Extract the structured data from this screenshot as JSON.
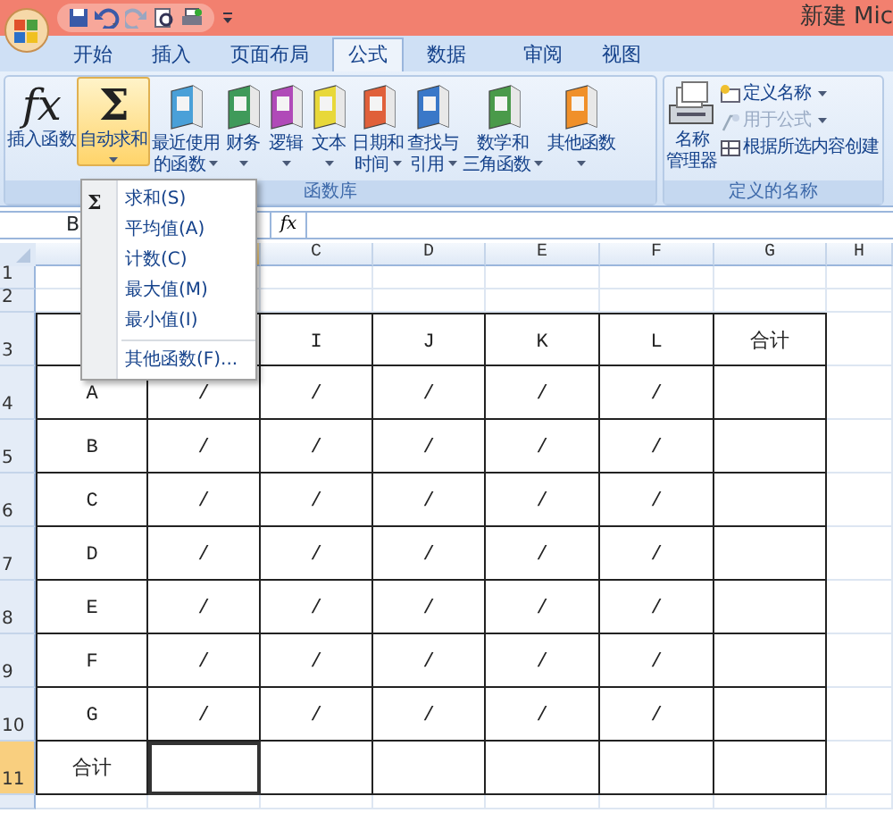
{
  "title_bar": {
    "title": "新建 Mic"
  },
  "tabs": [
    {
      "label": "开始",
      "selected": false
    },
    {
      "label": "插入",
      "selected": false
    },
    {
      "label": "页面布局",
      "selected": false
    },
    {
      "label": "公式",
      "selected": true
    },
    {
      "label": "数据",
      "selected": false
    },
    {
      "label": "审阅",
      "selected": false
    },
    {
      "label": "视图",
      "selected": false
    }
  ],
  "ribbon": {
    "groups": [
      {
        "label": "函数库",
        "buttons": [
          {
            "kind": "glyph",
            "glyph": "fx",
            "lines": [
              "插入函数"
            ],
            "dropdown": false,
            "active": false
          },
          {
            "kind": "glyph",
            "glyph": "Σ",
            "lines": [
              "自动求和"
            ],
            "dropdown": true,
            "active": true
          },
          {
            "kind": "book",
            "color": "#4aa0d8",
            "lines": [
              "最近使用",
              "的函数"
            ],
            "dropdown": true,
            "active": false
          },
          {
            "kind": "book",
            "color": "#3f9a5a",
            "lines": [
              "财务"
            ],
            "dropdown": true,
            "active": false
          },
          {
            "kind": "book",
            "color": "#b04ab8",
            "lines": [
              "逻辑"
            ],
            "dropdown": true,
            "active": false
          },
          {
            "kind": "book",
            "color": "#e8d83a",
            "lines": [
              "文本"
            ],
            "dropdown": true,
            "active": false
          },
          {
            "kind": "book",
            "color": "#e0603a",
            "lines": [
              "日期和",
              "时间"
            ],
            "dropdown": true,
            "active": false
          },
          {
            "kind": "book",
            "color": "#3a78c8",
            "lines": [
              "查找与",
              "引用"
            ],
            "dropdown": true,
            "active": false
          },
          {
            "kind": "book",
            "color": "#4a9a4a",
            "lines": [
              "数学和",
              "三角函数"
            ],
            "dropdown": true,
            "active": false
          },
          {
            "kind": "book",
            "color": "#f0902a",
            "lines": [
              "其他函数"
            ],
            "dropdown": true,
            "active": false
          }
        ]
      },
      {
        "label": "定义的名称",
        "buttons": [
          {
            "kind": "manager",
            "lines": [
              "名称",
              "管理器"
            ],
            "dropdown": false,
            "active": false
          }
        ],
        "small_items": [
          {
            "label": "定义名称",
            "dropdown": true,
            "disabled": false
          },
          {
            "label": "用于公式",
            "dropdown": true,
            "disabled": true
          },
          {
            "label": "根据所选内容创建",
            "dropdown": false,
            "disabled": false
          }
        ]
      }
    ]
  },
  "formula_bar": {
    "name_box": "B",
    "function_button": "fx"
  },
  "sheet": {
    "columns": [
      {
        "selected": false
      },
      {
        "selected": true
      },
      {
        "label": "C",
        "selected": false
      },
      {
        "label": "D",
        "selected": false
      },
      {
        "label": "E",
        "selected": false
      },
      {
        "label": "F",
        "selected": false
      },
      {
        "label": "G",
        "selected": false
      },
      {
        "label": "H",
        "selected": false
      }
    ],
    "rows": [
      {
        "header": "1",
        "selected": false
      },
      {
        "header": "2",
        "selected": false
      },
      {
        "header": "3",
        "selected": false,
        "cells": [
          null,
          null,
          "I",
          "J",
          "K",
          "L",
          "合计"
        ]
      },
      {
        "header": "4",
        "selected": false,
        "cells": [
          "A",
          "/",
          "/",
          "/",
          "/",
          "/",
          null
        ]
      },
      {
        "header": "5",
        "selected": false,
        "cells": [
          "B",
          "/",
          "/",
          "/",
          "/",
          "/",
          null
        ]
      },
      {
        "header": "6",
        "selected": false,
        "cells": [
          "C",
          "/",
          "/",
          "/",
          "/",
          "/",
          null
        ]
      },
      {
        "header": "7",
        "selected": false,
        "cells": [
          "D",
          "/",
          "/",
          "/",
          "/",
          "/",
          null
        ]
      },
      {
        "header": "8",
        "selected": false,
        "cells": [
          "E",
          "/",
          "/",
          "/",
          "/",
          "/",
          null
        ]
      },
      {
        "header": "9",
        "selected": false,
        "cells": [
          "F",
          "/",
          "/",
          "/",
          "/",
          "/",
          null
        ]
      },
      {
        "header": "10",
        "selected": false,
        "cells": [
          "G",
          "/",
          "/",
          "/",
          "/",
          "/",
          null
        ]
      },
      {
        "header": "11",
        "selected": true,
        "cells": [
          "合计",
          null,
          null,
          null,
          null,
          null,
          null
        ]
      },
      {
        "selected": false
      }
    ]
  },
  "menu": {
    "items": [
      {
        "label": "求和(S)",
        "icon": "Σ"
      },
      {
        "label": "平均值(A)"
      },
      {
        "label": "计数(C)"
      },
      {
        "label": "最大值(M)"
      },
      {
        "label": "最小值(I)"
      },
      {
        "kind": "separator"
      },
      {
        "label": "其他函数(F)..."
      }
    ]
  }
}
